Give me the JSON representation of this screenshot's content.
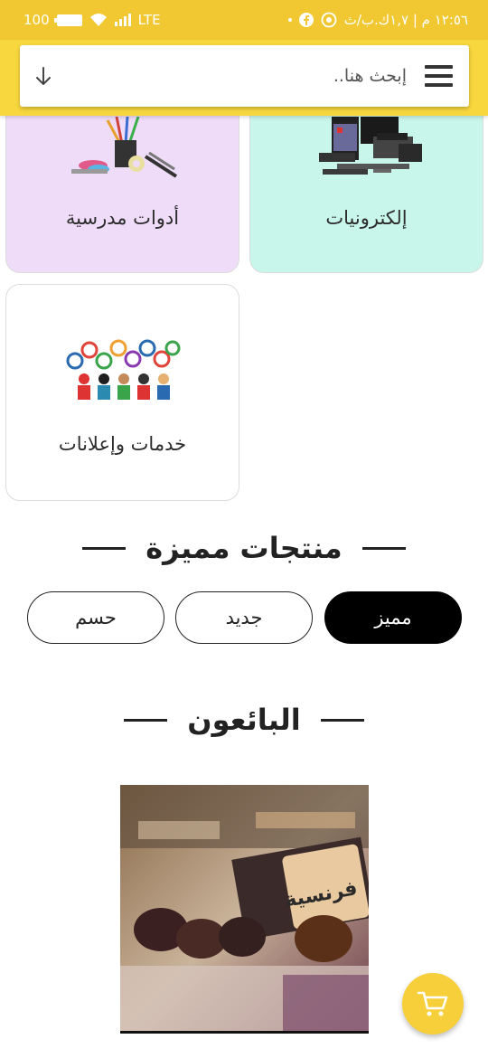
{
  "status_bar": {
    "time_text": "١٢:٥٦ م | ١,٧ك.ب/ث",
    "battery": "100",
    "network": "LTE"
  },
  "search": {
    "placeholder": "إبحث هنا.."
  },
  "categories": [
    {
      "label": "إلكترونيات",
      "icon": "electronics-image"
    },
    {
      "label": "أدوات مدرسية",
      "icon": "school-supplies-image"
    },
    {
      "label": "خدمات وإعلانات",
      "icon": "services-image"
    }
  ],
  "featured": {
    "title": "منتجات مميزة",
    "filters": [
      {
        "label": "مميز",
        "active": true
      },
      {
        "label": "جديد",
        "active": false
      },
      {
        "label": "حسم",
        "active": false
      }
    ]
  },
  "vendors": {
    "title": "البائعون",
    "logo_text": "فرنسية"
  },
  "colors": {
    "primary_yellow": "#f8d73e",
    "electronics_card": "#c9f6ea",
    "school_card": "#efdcf8"
  }
}
